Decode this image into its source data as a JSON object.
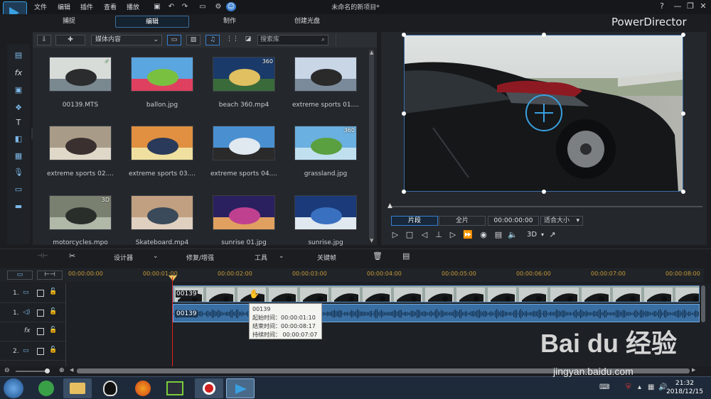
{
  "menu": [
    "文件",
    "编辑",
    "插件",
    "查看",
    "播放"
  ],
  "window_title": "未命名的新项目*",
  "window_controls": [
    "?",
    "—",
    "❐",
    "✕"
  ],
  "tabs": [
    {
      "label": "捕捉",
      "selected": false
    },
    {
      "label": "编辑",
      "selected": true
    },
    {
      "label": "制作",
      "selected": false
    },
    {
      "label": "创建光盘",
      "selected": false
    }
  ],
  "brand": "PowerDirector",
  "library": {
    "media_select": "媒体内容",
    "search_placeholder": "搜索库",
    "items": [
      {
        "label": "00139.MTS",
        "badge": "✓"
      },
      {
        "label": "ballon.jpg",
        "badge": ""
      },
      {
        "label": "beach 360.mp4",
        "badge": "360"
      },
      {
        "label": "extreme sports 01....",
        "badge": ""
      },
      {
        "label": "extreme sports 02....",
        "badge": ""
      },
      {
        "label": "extreme sports 03....",
        "badge": ""
      },
      {
        "label": "extreme sports 04....",
        "badge": ""
      },
      {
        "label": "grassland.jpg",
        "badge": "360"
      },
      {
        "label": "motorcycles.mpo",
        "badge": "3D"
      },
      {
        "label": "Skateboard.mp4",
        "badge": ""
      },
      {
        "label": "sunrise 01.jpg",
        "badge": ""
      },
      {
        "label": "sunrise.jpg",
        "badge": ""
      }
    ]
  },
  "preview": {
    "clip_button": "片段",
    "movie_button": "全片",
    "timecode": "00:00:00:00",
    "fit": "适合大小",
    "mode_3d": "3D"
  },
  "toolbar": {
    "designer": "设计器",
    "fix_enhance": "修复/增强",
    "tools": "工具",
    "keyframe": "关键帧"
  },
  "ruler_ticks": [
    "00:00:00:00",
    "00:00:01:00",
    "00:00:02:00",
    "00:00:03:00",
    "00:00:04:00",
    "00:00:05:00",
    "00:00:06:00",
    "00:00:07:00",
    "00:00:08:00"
  ],
  "tracks": [
    {
      "num": "1.",
      "type": "video"
    },
    {
      "num": "1.",
      "type": "audio"
    },
    {
      "num": "",
      "type": "fx"
    },
    {
      "num": "2.",
      "type": "video"
    }
  ],
  "clips": {
    "video_label": "00139",
    "audio_label": "00139"
  },
  "tooltip": {
    "name": "00139",
    "start": "起始时间：00:00:01:10",
    "end": "结束时间：00:00:08:17",
    "duration": "持续时间：  00:00:07:07"
  },
  "clock": {
    "time": "21:32",
    "date": "2018/12/15"
  },
  "watermark": {
    "main": "Bai du 经验",
    "sub": "jingyan.baidu.com"
  },
  "colors": {
    "accent": "#3aa0e0",
    "playhead": "#e02020",
    "ruler_text": "#c59a3a"
  }
}
